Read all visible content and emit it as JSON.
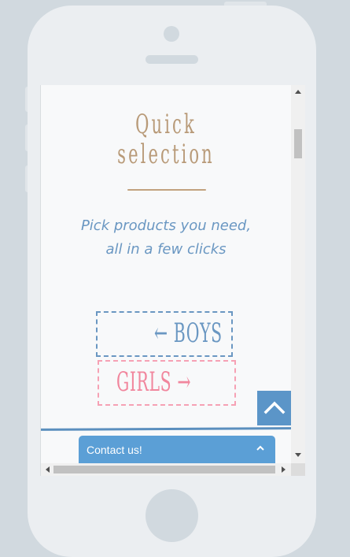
{
  "hero": {
    "title_line1": "Quick",
    "title_line2": "selection",
    "tagline_line1": "Pick products you need,",
    "tagline_line2": "all in a few clicks"
  },
  "buttons": {
    "boys_label": "← BOYS",
    "girls_label": "GIRLS →"
  },
  "contact_bar": {
    "label": "Contact us!",
    "icon": "chevron-up-icon"
  },
  "back_to_top": {
    "icon": "chevron-up-icon"
  },
  "colors": {
    "title": "#b89a78",
    "tagline": "#6a97c2",
    "boys": "#6a97c2",
    "girls": "#f1869d",
    "accent": "#5b9fd6",
    "phone_body": "#ebeef1",
    "background": "#d1d9df"
  }
}
